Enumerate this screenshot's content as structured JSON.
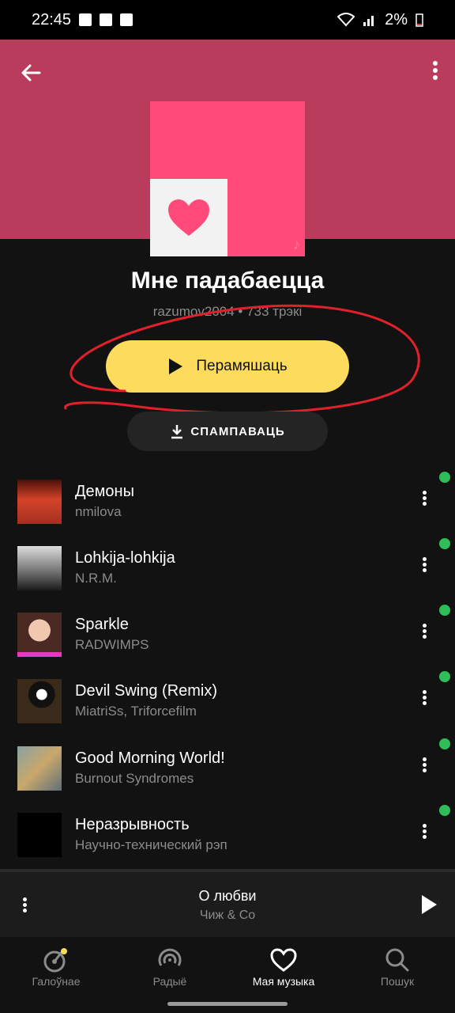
{
  "status": {
    "time": "22:45",
    "battery": "2%"
  },
  "playlist": {
    "title": "Мне падабаецца",
    "meta": "razumov2004 • 733 трэкі",
    "play_label": "Перамяшаць",
    "download_label": "СПАМПАВАЦЬ"
  },
  "tracks": [
    {
      "title": "Демоны",
      "artist": "nmilova"
    },
    {
      "title": "Lohkija-lohkija",
      "artist": "N.R.M."
    },
    {
      "title": "Sparkle",
      "artist": "RADWIMPS"
    },
    {
      "title": "Devil Swing (Remix)",
      "artist": "MiatriSs, Triforcefilm"
    },
    {
      "title": "Good Morning World!",
      "artist": "Burnout Syndromes"
    },
    {
      "title": "Неразрывность",
      "artist": "Научно-технический рэп"
    }
  ],
  "now_playing": {
    "title": "О любви",
    "artist": "Чиж & Co"
  },
  "nav": [
    {
      "label": "Галоўнае",
      "icon": "home-icon"
    },
    {
      "label": "Радыё",
      "icon": "radio-icon"
    },
    {
      "label": "Мая музыка",
      "icon": "heart-icon"
    },
    {
      "label": "Пошук",
      "icon": "search-icon"
    }
  ],
  "colors": {
    "accent": "#fddb5c",
    "header": "#b93c5c",
    "cover": "#ff4a7a",
    "annotation": "#e0202a"
  }
}
